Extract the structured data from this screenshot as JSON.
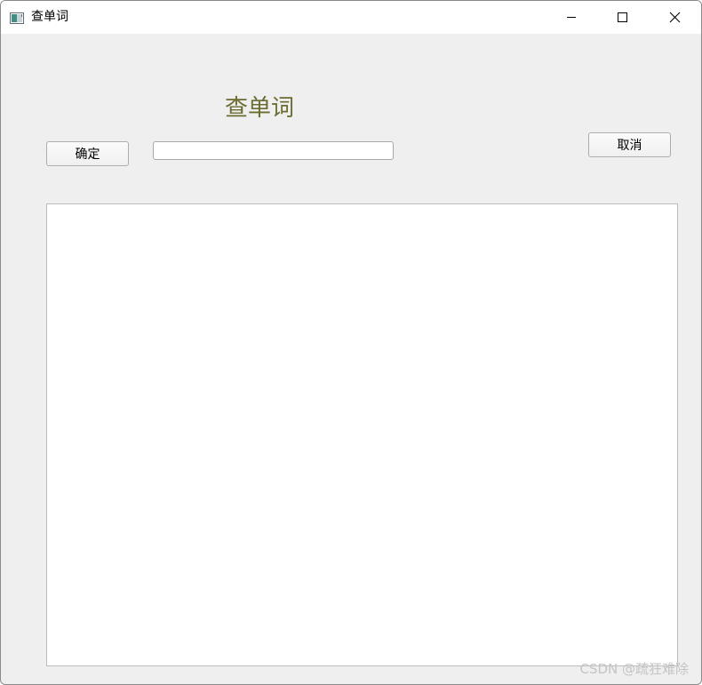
{
  "window": {
    "title": "查单词"
  },
  "main": {
    "heading": "查单词",
    "ok_label": "确定",
    "cancel_label": "取消",
    "word_input_value": "",
    "word_input_placeholder": "",
    "result_text": ""
  },
  "watermark": "CSDN @疏狂难除",
  "icons": {
    "app": "app-window-icon",
    "minimize": "minimize-icon",
    "maximize": "maximize-icon",
    "close": "close-icon"
  },
  "colors": {
    "heading": "#6b6b32",
    "client_background": "#efefef",
    "titlebar": "#ffffff"
  }
}
